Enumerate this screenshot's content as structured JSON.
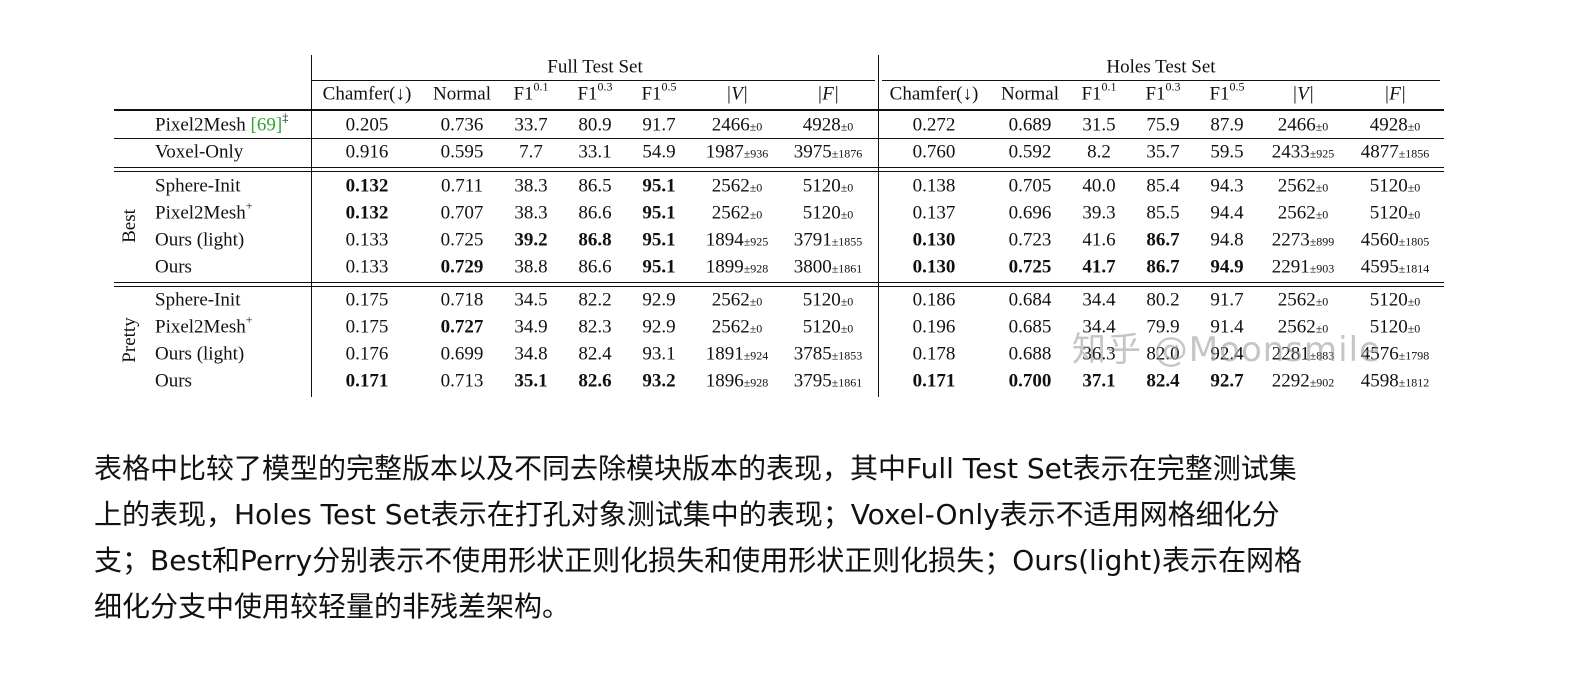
{
  "table": {
    "group_headers": [
      "Full Test Set",
      "Holes Test Set"
    ],
    "column_headers": [
      "Chamfer(↓)",
      "Normal",
      "F1^0.1",
      "F1^0.3",
      "F1^0.5",
      "|V|",
      "|F|"
    ],
    "row_groups": [
      {
        "label": "",
        "rows": [
          {
            "method": "Pixel2Mesh",
            "method_ref": "[69]",
            "method_sup": "‡",
            "cells": [
              {
                "v": "0.205"
              },
              {
                "v": "0.736"
              },
              {
                "v": "33.7"
              },
              {
                "v": "80.9"
              },
              {
                "v": "91.7"
              },
              {
                "v": "2466",
                "pm": "±0"
              },
              {
                "v": "4928",
                "pm": "±0"
              },
              {
                "v": "0.272"
              },
              {
                "v": "0.689"
              },
              {
                "v": "31.5"
              },
              {
                "v": "75.9"
              },
              {
                "v": "87.9"
              },
              {
                "v": "2466",
                "pm": "±0"
              },
              {
                "v": "4928",
                "pm": "±0"
              }
            ]
          },
          {
            "method": "Voxel-Only",
            "cells": [
              {
                "v": "0.916"
              },
              {
                "v": "0.595"
              },
              {
                "v": "7.7"
              },
              {
                "v": "33.1"
              },
              {
                "v": "54.9"
              },
              {
                "v": "1987",
                "pm": "±936"
              },
              {
                "v": "3975",
                "pm": "±1876"
              },
              {
                "v": "0.760"
              },
              {
                "v": "0.592"
              },
              {
                "v": "8.2"
              },
              {
                "v": "35.7"
              },
              {
                "v": "59.5"
              },
              {
                "v": "2433",
                "pm": "±925"
              },
              {
                "v": "4877",
                "pm": "±1856"
              }
            ]
          }
        ]
      },
      {
        "label": "Best",
        "rows": [
          {
            "method": "Sphere-Init",
            "cells": [
              {
                "v": "0.132",
                "bold": true
              },
              {
                "v": "0.711"
              },
              {
                "v": "38.3"
              },
              {
                "v": "86.5"
              },
              {
                "v": "95.1",
                "bold": true
              },
              {
                "v": "2562",
                "pm": "±0"
              },
              {
                "v": "5120",
                "pm": "±0"
              },
              {
                "v": "0.138"
              },
              {
                "v": "0.705"
              },
              {
                "v": "40.0"
              },
              {
                "v": "85.4"
              },
              {
                "v": "94.3"
              },
              {
                "v": "2562",
                "pm": "±0"
              },
              {
                "v": "5120",
                "pm": "±0"
              }
            ]
          },
          {
            "method": "Pixel2Mesh",
            "method_sup": "+",
            "cells": [
              {
                "v": "0.132",
                "bold": true
              },
              {
                "v": "0.707"
              },
              {
                "v": "38.3"
              },
              {
                "v": "86.6"
              },
              {
                "v": "95.1",
                "bold": true
              },
              {
                "v": "2562",
                "pm": "±0"
              },
              {
                "v": "5120",
                "pm": "±0"
              },
              {
                "v": "0.137"
              },
              {
                "v": "0.696"
              },
              {
                "v": "39.3"
              },
              {
                "v": "85.5"
              },
              {
                "v": "94.4"
              },
              {
                "v": "2562",
                "pm": "±0"
              },
              {
                "v": "5120",
                "pm": "±0"
              }
            ]
          },
          {
            "method": "Ours (light)",
            "cells": [
              {
                "v": "0.133"
              },
              {
                "v": "0.725"
              },
              {
                "v": "39.2",
                "bold": true
              },
              {
                "v": "86.8",
                "bold": true
              },
              {
                "v": "95.1",
                "bold": true
              },
              {
                "v": "1894",
                "pm": "±925"
              },
              {
                "v": "3791",
                "pm": "±1855"
              },
              {
                "v": "0.130",
                "bold": true
              },
              {
                "v": "0.723"
              },
              {
                "v": "41.6"
              },
              {
                "v": "86.7",
                "bold": true
              },
              {
                "v": "94.8"
              },
              {
                "v": "2273",
                "pm": "±899"
              },
              {
                "v": "4560",
                "pm": "±1805"
              }
            ]
          },
          {
            "method": "Ours",
            "cells": [
              {
                "v": "0.133"
              },
              {
                "v": "0.729",
                "bold": true
              },
              {
                "v": "38.8"
              },
              {
                "v": "86.6"
              },
              {
                "v": "95.1",
                "bold": true
              },
              {
                "v": "1899",
                "pm": "±928"
              },
              {
                "v": "3800",
                "pm": "±1861"
              },
              {
                "v": "0.130",
                "bold": true
              },
              {
                "v": "0.725",
                "bold": true
              },
              {
                "v": "41.7",
                "bold": true
              },
              {
                "v": "86.7",
                "bold": true
              },
              {
                "v": "94.9",
                "bold": true
              },
              {
                "v": "2291",
                "pm": "±903"
              },
              {
                "v": "4595",
                "pm": "±1814"
              }
            ]
          }
        ]
      },
      {
        "label": "Pretty",
        "rows": [
          {
            "method": "Sphere-Init",
            "cells": [
              {
                "v": "0.175"
              },
              {
                "v": "0.718"
              },
              {
                "v": "34.5"
              },
              {
                "v": "82.2"
              },
              {
                "v": "92.9"
              },
              {
                "v": "2562",
                "pm": "±0"
              },
              {
                "v": "5120",
                "pm": "±0"
              },
              {
                "v": "0.186"
              },
              {
                "v": "0.684"
              },
              {
                "v": "34.4"
              },
              {
                "v": "80.2"
              },
              {
                "v": "91.7"
              },
              {
                "v": "2562",
                "pm": "±0"
              },
              {
                "v": "5120",
                "pm": "±0"
              }
            ]
          },
          {
            "method": "Pixel2Mesh",
            "method_sup": "+",
            "cells": [
              {
                "v": "0.175"
              },
              {
                "v": "0.727",
                "bold": true
              },
              {
                "v": "34.9"
              },
              {
                "v": "82.3"
              },
              {
                "v": "92.9"
              },
              {
                "v": "2562",
                "pm": "±0"
              },
              {
                "v": "5120",
                "pm": "±0"
              },
              {
                "v": "0.196"
              },
              {
                "v": "0.685"
              },
              {
                "v": "34.4"
              },
              {
                "v": "79.9"
              },
              {
                "v": "91.4"
              },
              {
                "v": "2562",
                "pm": "±0"
              },
              {
                "v": "5120",
                "pm": "±0"
              }
            ]
          },
          {
            "method": "Ours (light)",
            "cells": [
              {
                "v": "0.176"
              },
              {
                "v": "0.699"
              },
              {
                "v": "34.8"
              },
              {
                "v": "82.4"
              },
              {
                "v": "93.1"
              },
              {
                "v": "1891",
                "pm": "±924"
              },
              {
                "v": "3785",
                "pm": "±1853"
              },
              {
                "v": "0.178"
              },
              {
                "v": "0.688"
              },
              {
                "v": "36.3"
              },
              {
                "v": "82.0"
              },
              {
                "v": "92.4"
              },
              {
                "v": "2281",
                "pm": "±883"
              },
              {
                "v": "4576",
                "pm": "±1798"
              }
            ]
          },
          {
            "method": "Ours",
            "cells": [
              {
                "v": "0.171",
                "bold": true
              },
              {
                "v": "0.713"
              },
              {
                "v": "35.1",
                "bold": true
              },
              {
                "v": "82.6",
                "bold": true
              },
              {
                "v": "93.2",
                "bold": true
              },
              {
                "v": "1896",
                "pm": "±928"
              },
              {
                "v": "3795",
                "pm": "±1861"
              },
              {
                "v": "0.171",
                "bold": true
              },
              {
                "v": "0.700",
                "bold": true
              },
              {
                "v": "37.1",
                "bold": true
              },
              {
                "v": "82.4",
                "bold": true
              },
              {
                "v": "92.7",
                "bold": true
              },
              {
                "v": "2292",
                "pm": "±902"
              },
              {
                "v": "4598",
                "pm": "±1812"
              }
            ]
          }
        ]
      }
    ]
  },
  "watermark": "知乎 @Moonsmile",
  "caption": [
    "表格中比较了模型的完整版本以及不同去除模块版本的表现，其中Full Test Set表示在完整测试集",
    "上的表现，Holes Test Set表示在打孔对象测试集中的表现；Voxel-Only表示不适用网格细化分",
    "支；Best和Perry分别表示不使用形状正则化损失和使用形状正则化损失；Ours(light)表示在网格",
    "细化分支中使用较轻量的非残差架构。"
  ]
}
